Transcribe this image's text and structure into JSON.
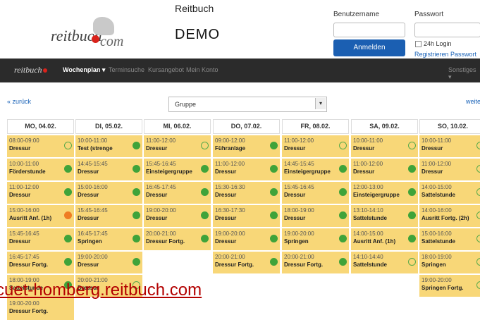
{
  "header": {
    "brand": "Reitbuch",
    "demo": "DEMO",
    "logo_main": "reitbuch",
    "logo_suffix": "com",
    "username_label": "Benutzername",
    "password_label": "Passwort",
    "login_button": "Anmelden",
    "remember_label": "24h Login",
    "register_link": "Registrieren Passwort"
  },
  "nav": {
    "logo": "reitbuch",
    "items": [
      "Wochenplan ▾",
      "Terminsuche",
      "Kursangebot",
      "Mein Konto"
    ],
    "right": "Sonstiges ▾"
  },
  "controls": {
    "back": "« zurück",
    "forward": "weite",
    "group_select": "Gruppe"
  },
  "days": [
    {
      "label": "MO, 04.02.",
      "slots": [
        {
          "time": "08:00-09:00",
          "name": "Dressur",
          "status": "open"
        },
        {
          "time": "10:00-11:00",
          "name": "Förderstunde",
          "status": "full"
        },
        {
          "time": "11:00-12:00",
          "name": "Dressur",
          "status": "full"
        },
        {
          "time": "15:00-16:00",
          "name": "Ausritt Anf. (1h)",
          "status": "wait"
        },
        {
          "time": "15:45-16:45",
          "name": "Dressur",
          "status": "full"
        },
        {
          "time": "16:45-17:45",
          "name": "Dressur Fortg.",
          "status": "full"
        },
        {
          "time": "18:00-19:00",
          "name": "Sattelstunde",
          "status": "full"
        },
        {
          "time": "19:00-20:00",
          "name": "Dressur Fortg.",
          "status": "none"
        }
      ]
    },
    {
      "label": "DI, 05.02.",
      "slots": [
        {
          "time": "10:00-11:00",
          "name": "Test (strenge",
          "status": "full"
        },
        {
          "time": "14:45-15:45",
          "name": "Dressur",
          "status": "full"
        },
        {
          "time": "15:00-16:00",
          "name": "Dressur",
          "status": "full"
        },
        {
          "time": "15:45-16:45",
          "name": "Dressur",
          "status": "full"
        },
        {
          "time": "16:45-17:45",
          "name": "Springen",
          "status": "full"
        },
        {
          "time": "19:00-20:00",
          "name": "Dressur",
          "status": "full"
        },
        {
          "time": "20:00-21:00",
          "name": "Dressur",
          "status": "open"
        }
      ]
    },
    {
      "label": "MI, 06.02.",
      "slots": [
        {
          "time": "11:00-12:00",
          "name": "Dressur",
          "status": "open"
        },
        {
          "time": "15:45-16:45",
          "name": "Einsteigergruppe",
          "status": "full"
        },
        {
          "time": "16:45-17:45",
          "name": "Dressur",
          "status": "full"
        },
        {
          "time": "19:00-20:00",
          "name": "Dressur",
          "status": "full"
        },
        {
          "time": "20:00-21:00",
          "name": "Dressur Fortg.",
          "status": "full"
        }
      ]
    },
    {
      "label": "DO, 07.02.",
      "slots": [
        {
          "time": "09:00-12:00",
          "name": "Führanlage",
          "status": "full"
        },
        {
          "time": "11:00-12:00",
          "name": "Dressur",
          "status": "full"
        },
        {
          "time": "15:30-16:30",
          "name": "Dressur",
          "status": "full"
        },
        {
          "time": "16:30-17:30",
          "name": "Dressur",
          "status": "full"
        },
        {
          "time": "19:00-20:00",
          "name": "Dressur",
          "status": "full"
        },
        {
          "time": "20:00-21:00",
          "name": "Dressur Fortg.",
          "status": "full"
        }
      ]
    },
    {
      "label": "FR, 08.02.",
      "slots": [
        {
          "time": "11:00-12:00",
          "name": "Dressur",
          "status": "open"
        },
        {
          "time": "14:45-15:45",
          "name": "Einsteigergruppe",
          "status": "full"
        },
        {
          "time": "15:45-16:45",
          "name": "Dressur",
          "status": "full"
        },
        {
          "time": "18:00-19:00",
          "name": "Dressur",
          "status": "full"
        },
        {
          "time": "19:00-20:00",
          "name": "Springen",
          "status": "full"
        },
        {
          "time": "20:00-21:00",
          "name": "Dressur Fortg.",
          "status": "full"
        }
      ]
    },
    {
      "label": "SA, 09.02.",
      "slots": [
        {
          "time": "10:00-11:00",
          "name": "Dressur",
          "status": "open"
        },
        {
          "time": "11:00-12:00",
          "name": "Dressur",
          "status": "full"
        },
        {
          "time": "12:00-13:00",
          "name": "Einsteigergruppe",
          "status": "full"
        },
        {
          "time": "13:10-14:10",
          "name": "Sattelstunde",
          "status": "full"
        },
        {
          "time": "14:00-15:00",
          "name": "Ausritt Anf. (1h)",
          "status": "full"
        },
        {
          "time": "14:10-14:40",
          "name": "Sattelstunde",
          "status": "open"
        }
      ]
    },
    {
      "label": "SO, 10.02.",
      "slots": [
        {
          "time": "10:00-11:00",
          "name": "Dressur",
          "status": "open"
        },
        {
          "time": "11:00-12:00",
          "name": "Dressur",
          "status": "open"
        },
        {
          "time": "14:00-15:00",
          "name": "Sattelstunde",
          "status": "open"
        },
        {
          "time": "14:00-16:00",
          "name": "Ausritt Fortg. (2h)",
          "status": "open"
        },
        {
          "time": "15:00-16:00",
          "name": "Sattelstunde",
          "status": "open"
        },
        {
          "time": "18:00-19:00",
          "name": "Springen",
          "status": "open"
        },
        {
          "time": "19:00-20:00",
          "name": "Springen Fortg.",
          "status": "open"
        }
      ]
    }
  ],
  "footer_url": "cuet-homberg.reitbuch.com",
  "colors": {
    "slot": "#f8d778",
    "full": "#3fa33a",
    "wait": "#ef7d24",
    "nav": "#2b2b2b",
    "button": "#1b5fb2"
  }
}
